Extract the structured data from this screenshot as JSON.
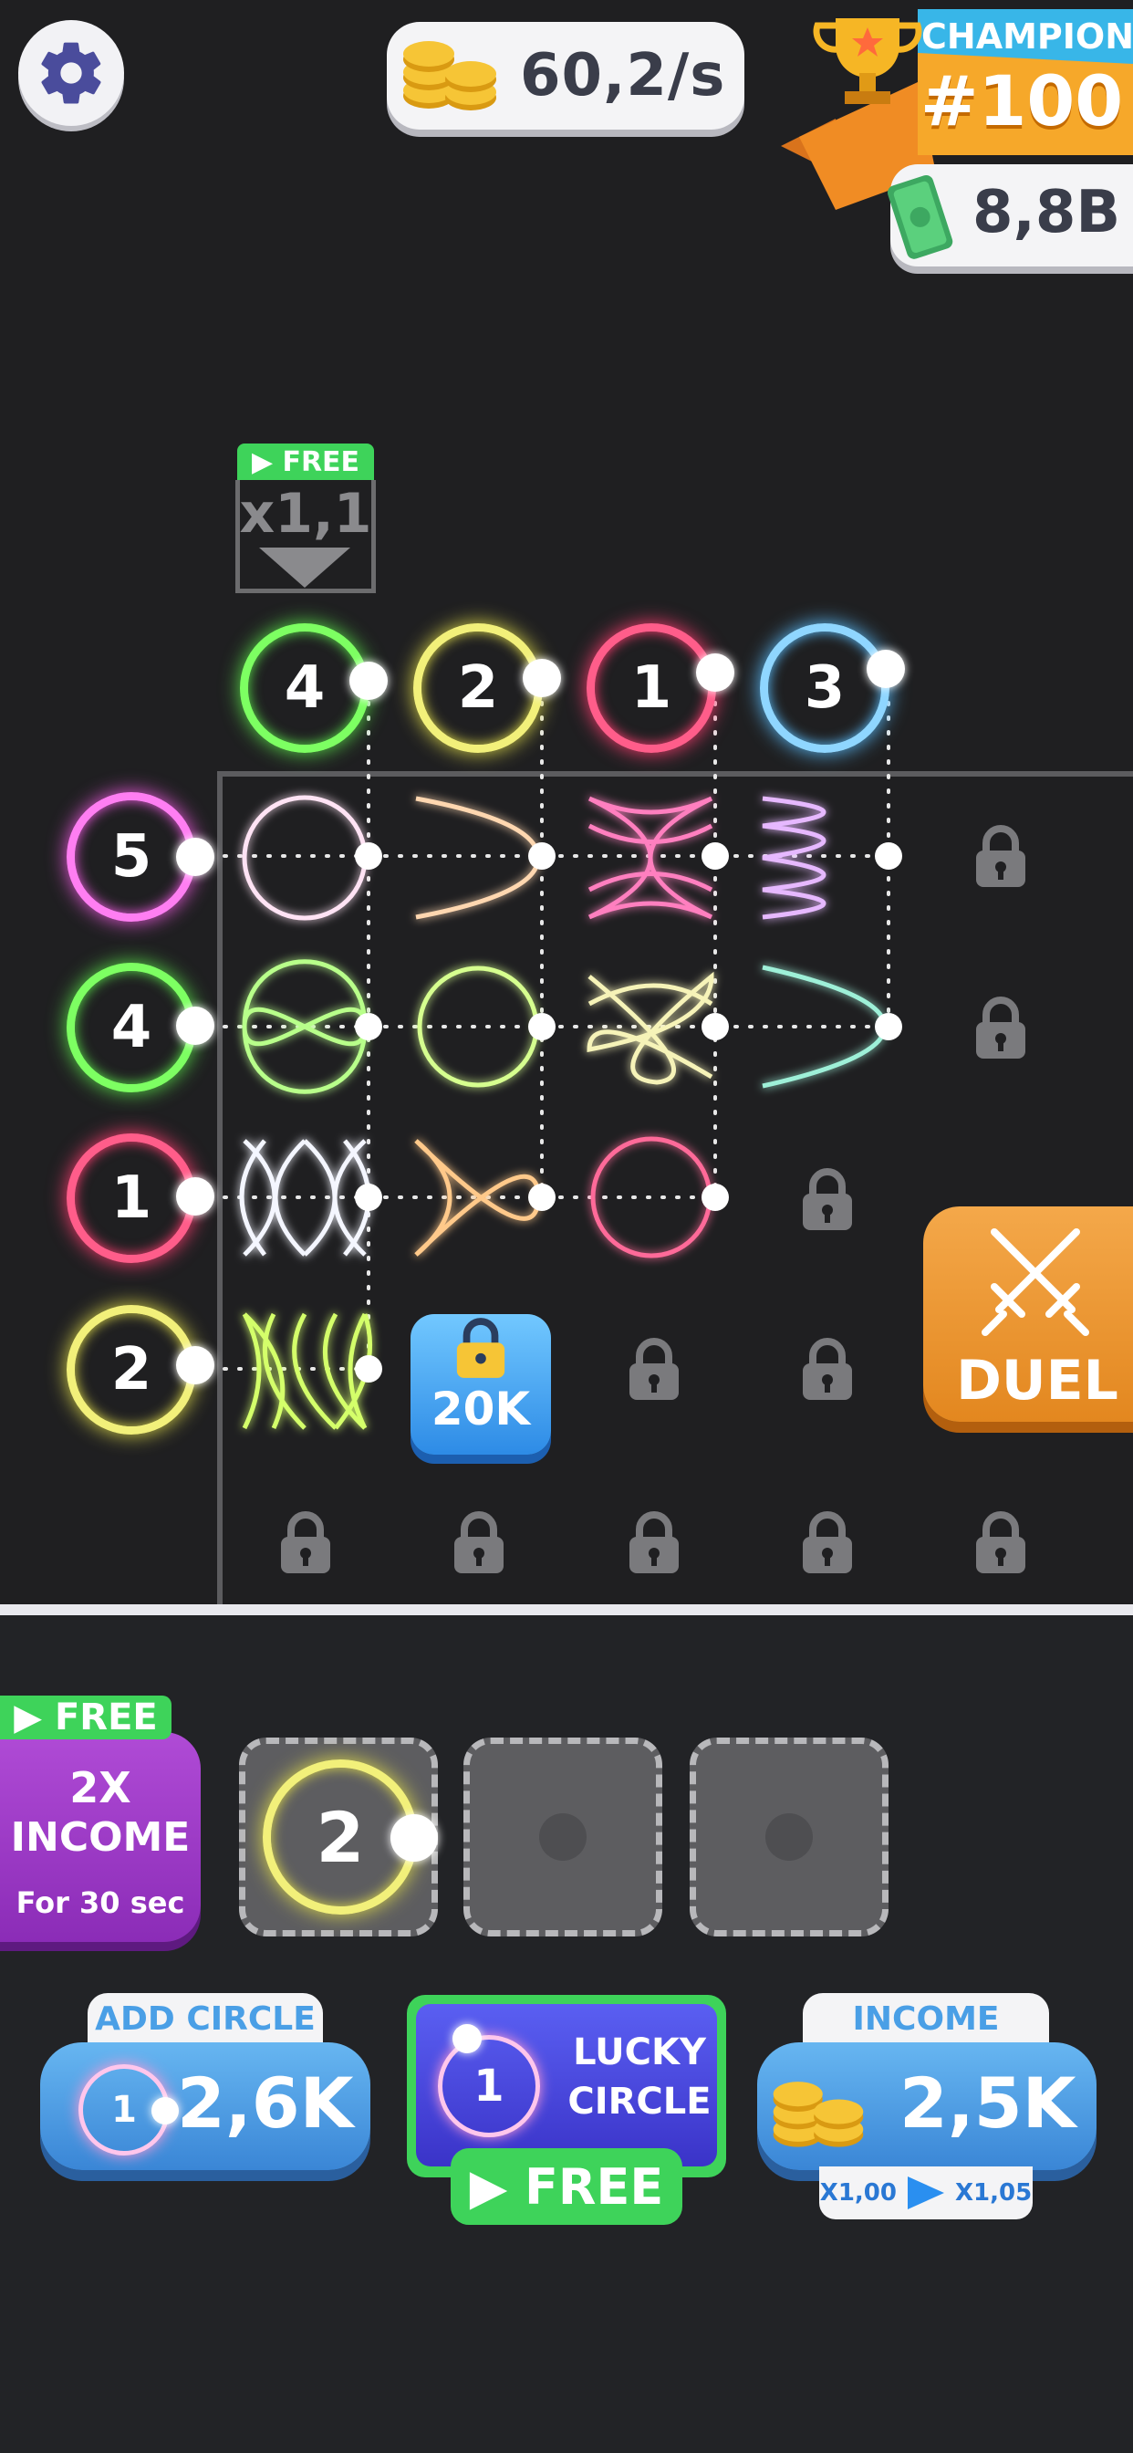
{
  "top_bar": {
    "settings_icon": "gear-icon",
    "income_rate": "60,2/s",
    "coins_icon": "coins-icon",
    "champions": {
      "title": "CHAMPIONS",
      "rank": "#100",
      "trophy_icon": "trophy-icon"
    },
    "cash": "8,8B",
    "cash_icon": "cash-icon"
  },
  "column_booster": {
    "free_label": "▶ FREE",
    "multiplier": "x1,1"
  },
  "column_circles": [
    "4",
    "2",
    "1",
    "3"
  ],
  "row_circles": [
    "5",
    "4",
    "1",
    "2"
  ],
  "unlock_tile": {
    "price": "20K",
    "icon": "lock-icon"
  },
  "duel_button": {
    "label": "DUEL",
    "icon": "crossed-swords-icon"
  },
  "bonus": {
    "free_label": "▶ FREE",
    "line1": "2X",
    "line2": "INCOME",
    "line3": "For 30 sec"
  },
  "inventory": {
    "slot1_value": "2"
  },
  "add_circle": {
    "title": "ADD CIRCLE",
    "circle_value": "1",
    "price": "2,6K"
  },
  "lucky_circle": {
    "circle_value": "1",
    "line1": "LUCKY",
    "line2": "CIRCLE",
    "free_label": "▶ FREE"
  },
  "income_upgrade": {
    "title": "INCOME",
    "price": "2,5K",
    "mult_from": "X1,00",
    "mult_to": "X1,05"
  },
  "colors": {
    "green": "#7dff62",
    "yellow": "#f2f07a",
    "pink": "#ff5d8a",
    "blue": "#8fd6ff",
    "magenta": "#ff7ef2",
    "free_green": "#3ed35a",
    "duel_orange": "#f0a23a"
  }
}
